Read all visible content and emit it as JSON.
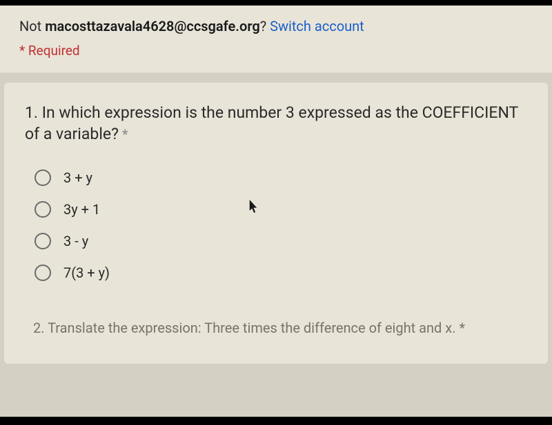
{
  "header": {
    "not_label": "Not ",
    "email": "macosttazavala4628@ccsgafe.org",
    "question_mark": "? ",
    "switch_account": "Switch account",
    "asterisk": "* ",
    "required": "Required"
  },
  "question1": {
    "number_prefix": "1. ",
    "text": "In which expression is the number 3 expressed as the COEFFICIENT of a variable?",
    "required_mark": " *",
    "options": [
      "3 + y",
      "3y + 1",
      "3 - y",
      "7(3 + y)"
    ]
  },
  "question2": {
    "text": "2. Translate the expression: Three times the difference of eight and x. *"
  }
}
